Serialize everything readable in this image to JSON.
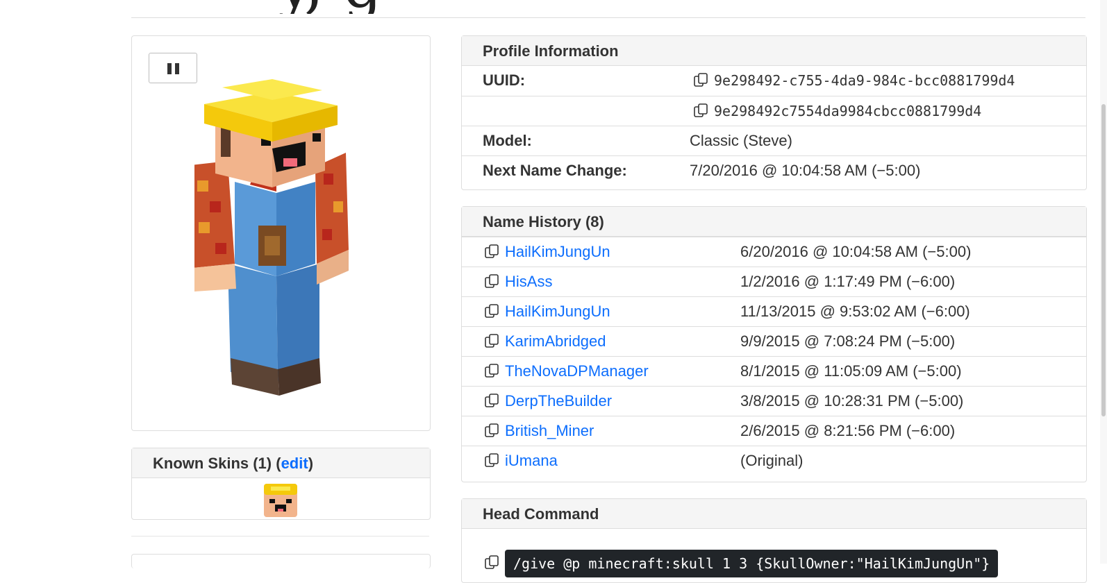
{
  "page": {
    "title_fragment": "y, g"
  },
  "skin_viewer": {
    "pause_icon": "pause-icon"
  },
  "known_skins": {
    "prefix": "Known Skins (1) (",
    "edit_label": "edit",
    "suffix": ")"
  },
  "profile": {
    "header": "Profile Information",
    "uuid_label": "UUID:",
    "uuid_dashed": "9e298492-c755-4da9-984c-bcc0881799d4",
    "uuid_plain": "9e298492c7554da9984cbcc0881799d4",
    "model_label": "Model:",
    "model_value": "Classic (Steve)",
    "next_change_label": "Next Name Change:",
    "next_change_value": "7/20/2016 @ 10:04:58 AM (−5:00)"
  },
  "name_history": {
    "header": "Name History (8)",
    "rows": [
      {
        "name": "HailKimJungUn",
        "date": "6/20/2016 @ 10:04:58 AM (−5:00)"
      },
      {
        "name": "HisAss",
        "date": "1/2/2016 @ 1:17:49 PM (−6:00)"
      },
      {
        "name": "HailKimJungUn",
        "date": "11/13/2015 @ 9:53:02 AM (−6:00)"
      },
      {
        "name": "KarimAbridged",
        "date": "9/9/2015 @ 7:08:24 PM (−5:00)"
      },
      {
        "name": "TheNovaDPManager",
        "date": "8/1/2015 @ 11:05:09 AM (−5:00)"
      },
      {
        "name": "DerpTheBuilder",
        "date": "3/8/2015 @ 10:28:31 PM (−5:00)"
      },
      {
        "name": "British_Miner",
        "date": "2/6/2015 @ 8:21:56 PM (−6:00)"
      },
      {
        "name": "iUmana",
        "date": "(Original)"
      }
    ]
  },
  "head_command": {
    "header": "Head Command",
    "command": "/give @p minecraft:skull 1 3 {SkullOwner:\"HailKimJungUn\"}"
  },
  "colors": {
    "link": "#0d6efd",
    "panel_head_bg": "#f5f5f5",
    "code_bg": "#212529"
  }
}
